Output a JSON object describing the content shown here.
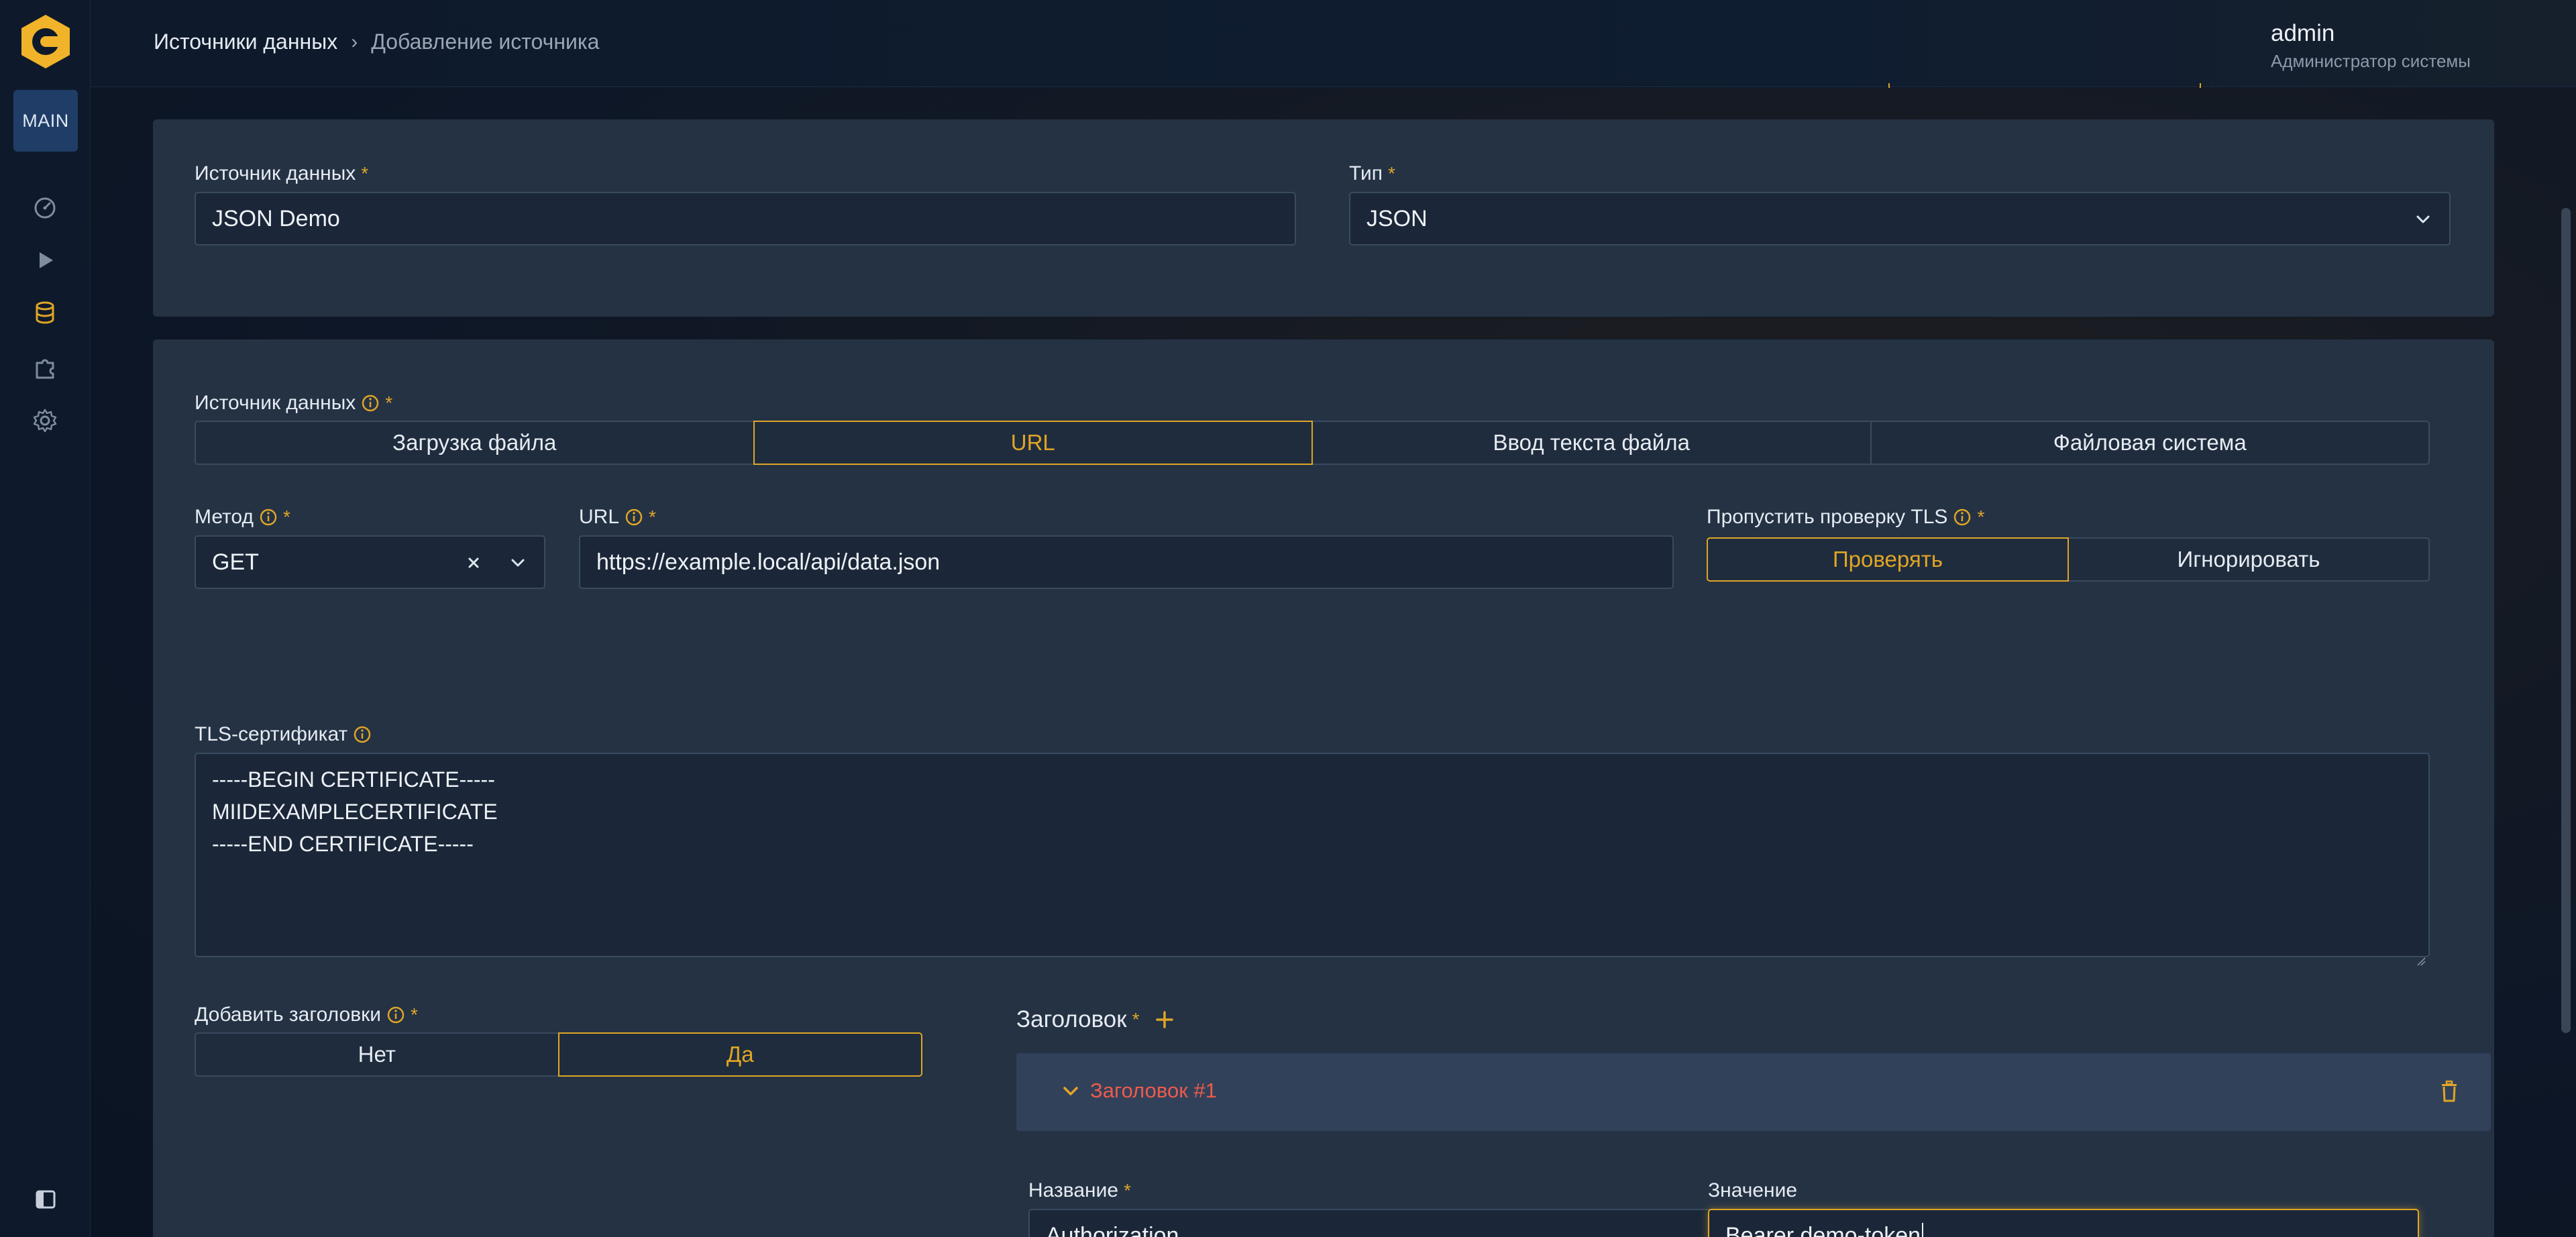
{
  "sidebar": {
    "badge": "MAIN",
    "items": [
      {
        "icon": "dashboard-icon"
      },
      {
        "icon": "play-icon"
      },
      {
        "icon": "database-icon"
      },
      {
        "icon": "puzzle-icon"
      },
      {
        "icon": "gear-icon"
      }
    ]
  },
  "breadcrumb": {
    "root": "Источники данных",
    "sep": "›",
    "current": "Добавление источника"
  },
  "user": {
    "name": "admin",
    "role": "Администратор системы"
  },
  "form": {
    "source_name": {
      "label": "Источник данных",
      "required": "*",
      "value": "JSON Demo"
    },
    "type": {
      "label": "Тип",
      "required": "*",
      "value": "JSON"
    },
    "source_mode": {
      "label": "Источник данных",
      "required": "*",
      "options": [
        "Загрузка файла",
        "URL",
        "Ввод текста файла",
        "Файловая система"
      ],
      "selected": "URL"
    },
    "method": {
      "label": "Метод",
      "required": "*",
      "value": "GET"
    },
    "url": {
      "label": "URL",
      "required": "*",
      "value": "https://example.local/api/data.json"
    },
    "skip_tls": {
      "label": "Пропустить проверку TLS",
      "required": "*",
      "options": [
        "Проверять",
        "Игнорировать"
      ],
      "selected": "Проверять"
    },
    "tls_cert": {
      "label": "TLS-сертификат",
      "lines": [
        "-----BEGIN CERTIFICATE-----",
        "MIIDEXAMPLECERTIFICATE",
        "-----END CERTIFICATE-----"
      ]
    },
    "add_headers": {
      "label": "Добавить заголовки",
      "required": "*",
      "options": [
        "Нет",
        "Да"
      ],
      "selected": "Да"
    },
    "headers": {
      "title": "Заголовок",
      "required": "*",
      "items": [
        {
          "title": "Заголовок #1",
          "name_label": "Название",
          "name_required": "*",
          "name_value": "Authorization",
          "value_label": "Значение",
          "value_value": "Bearer demo-token"
        }
      ]
    }
  },
  "colors": {
    "accent": "#e0a526",
    "error_title": "#ef5a4b",
    "card": "#243244",
    "input_bg": "#1b2738"
  }
}
